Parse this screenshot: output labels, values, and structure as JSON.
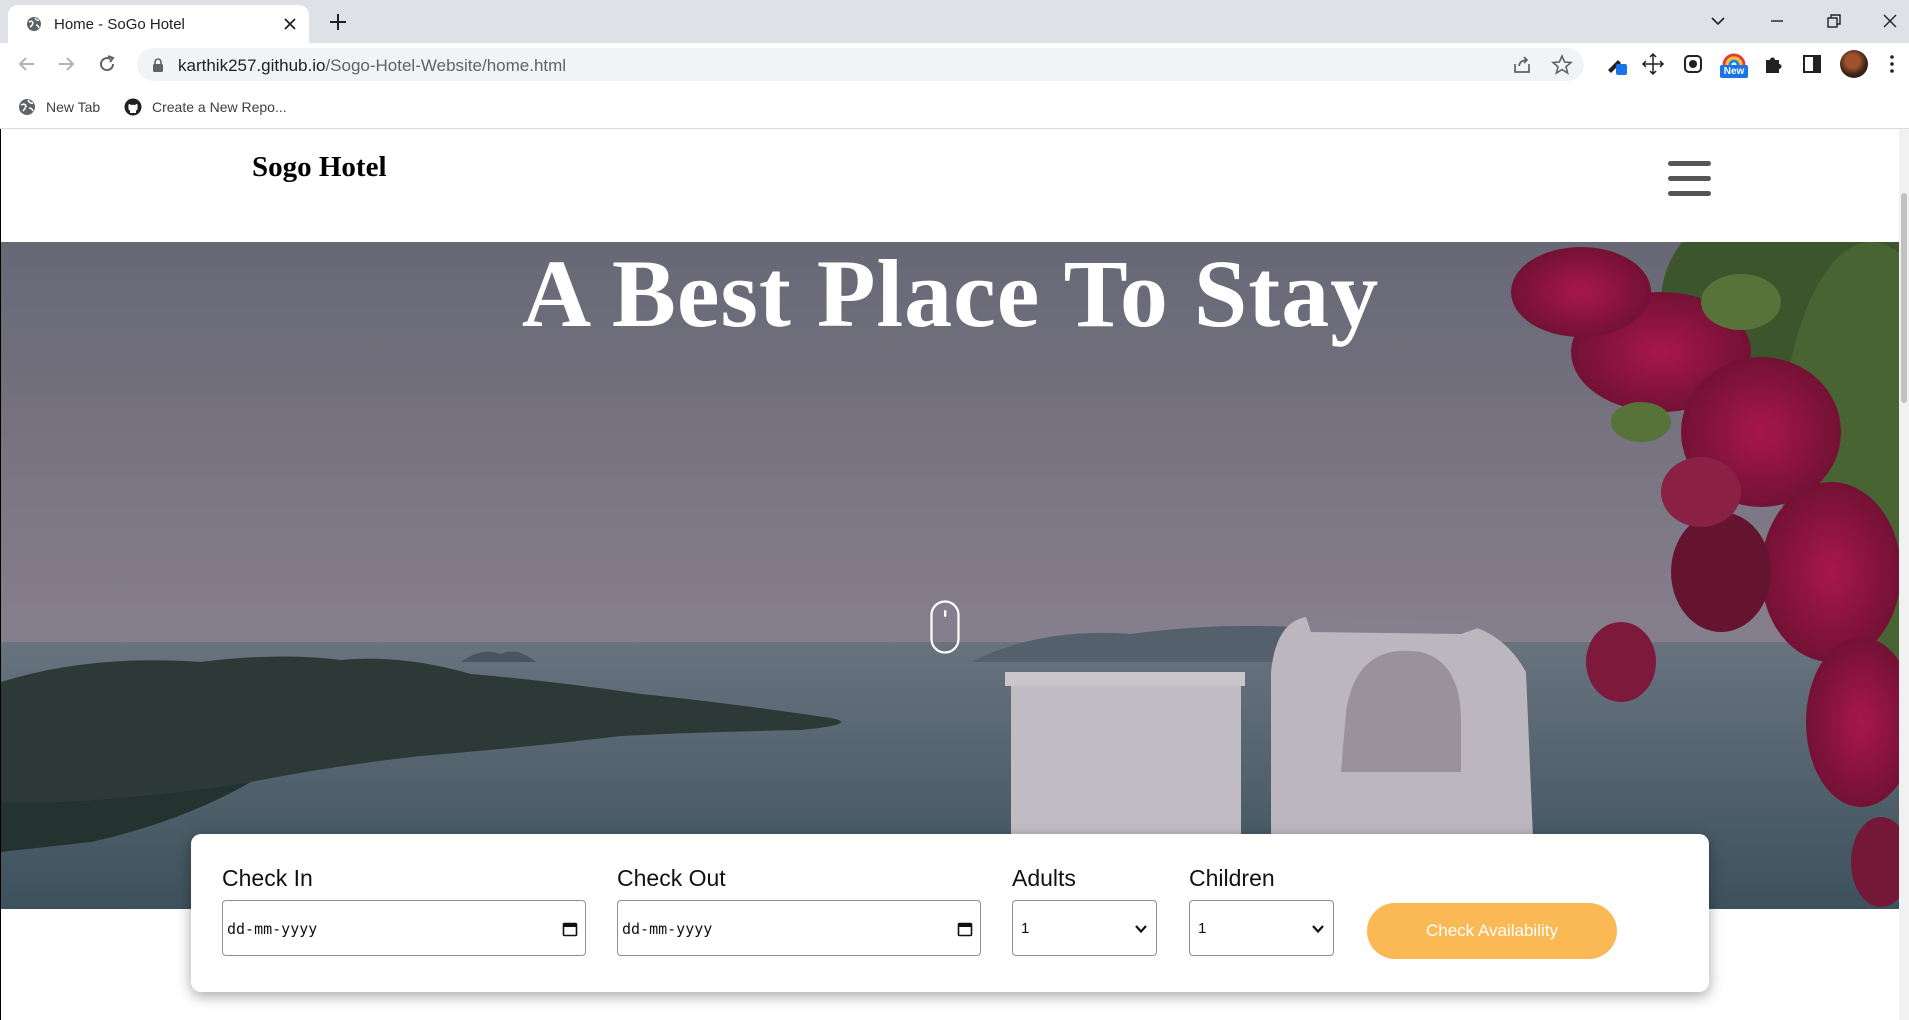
{
  "browser": {
    "tab_title": "Home - SoGo Hotel",
    "url_host": "karthik257.github.io",
    "url_path": "/Sogo-Hotel-Website/home.html",
    "extension_badge": "New",
    "bookmarks": [
      {
        "label": "New Tab",
        "icon": "globe-icon"
      },
      {
        "label": "Create a New Repo...",
        "icon": "github-icon"
      }
    ]
  },
  "site": {
    "logo": "Sogo Hotel",
    "hero_title": "A Best Place To Stay"
  },
  "booking": {
    "check_in_label": "Check In",
    "check_in_value": "dd-mm-yyyy",
    "check_out_label": "Check Out",
    "check_out_value": "dd-mm-yyyy",
    "adults_label": "Adults",
    "adults_value": "1",
    "children_label": "Children",
    "children_value": "1",
    "button_label": "Check Availability"
  },
  "colors": {
    "accent": "#fbb955",
    "tabbar": "#dee1e6",
    "omnibox": "#f1f3f4"
  }
}
